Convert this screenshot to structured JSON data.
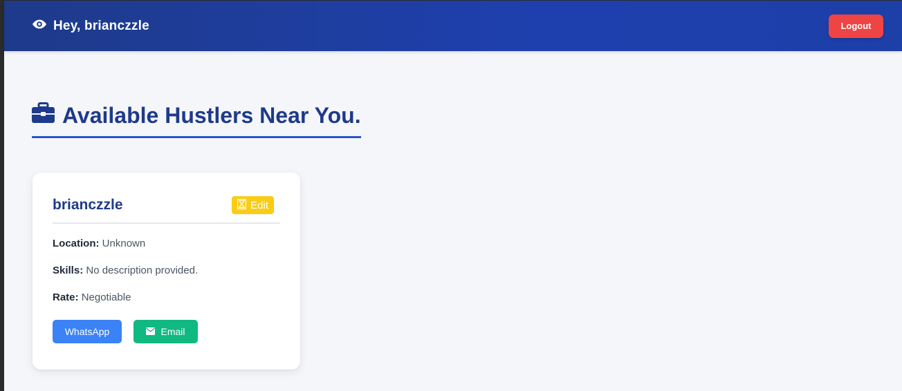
{
  "navbar": {
    "icon": "eye-icon",
    "greeting": "Hey, brianczzle",
    "logout_label": "Logout"
  },
  "section": {
    "icon": "briefcase-icon",
    "title": "Available Hustlers Near You."
  },
  "card": {
    "name": "brianczzle",
    "edit_icon": "hourglass-icon",
    "edit_label": "Edit",
    "location_label": "Location:",
    "location_value": "Unknown",
    "skills_label": "Skills:",
    "skills_value": "No description provided.",
    "rate_label": "Rate:",
    "rate_value": "Negotiable",
    "whatsapp_label": "WhatsApp",
    "email_icon": "envelope-icon",
    "email_label": "Email"
  },
  "colors": {
    "navbar_bg": "#1e3a8a",
    "title_color": "#1e3a8a",
    "logout_bg": "#ef4444",
    "edit_bg": "#facc15",
    "whatsapp_bg": "#3b82f6",
    "email_bg": "#10b981",
    "page_bg": "#f5f6fa"
  }
}
